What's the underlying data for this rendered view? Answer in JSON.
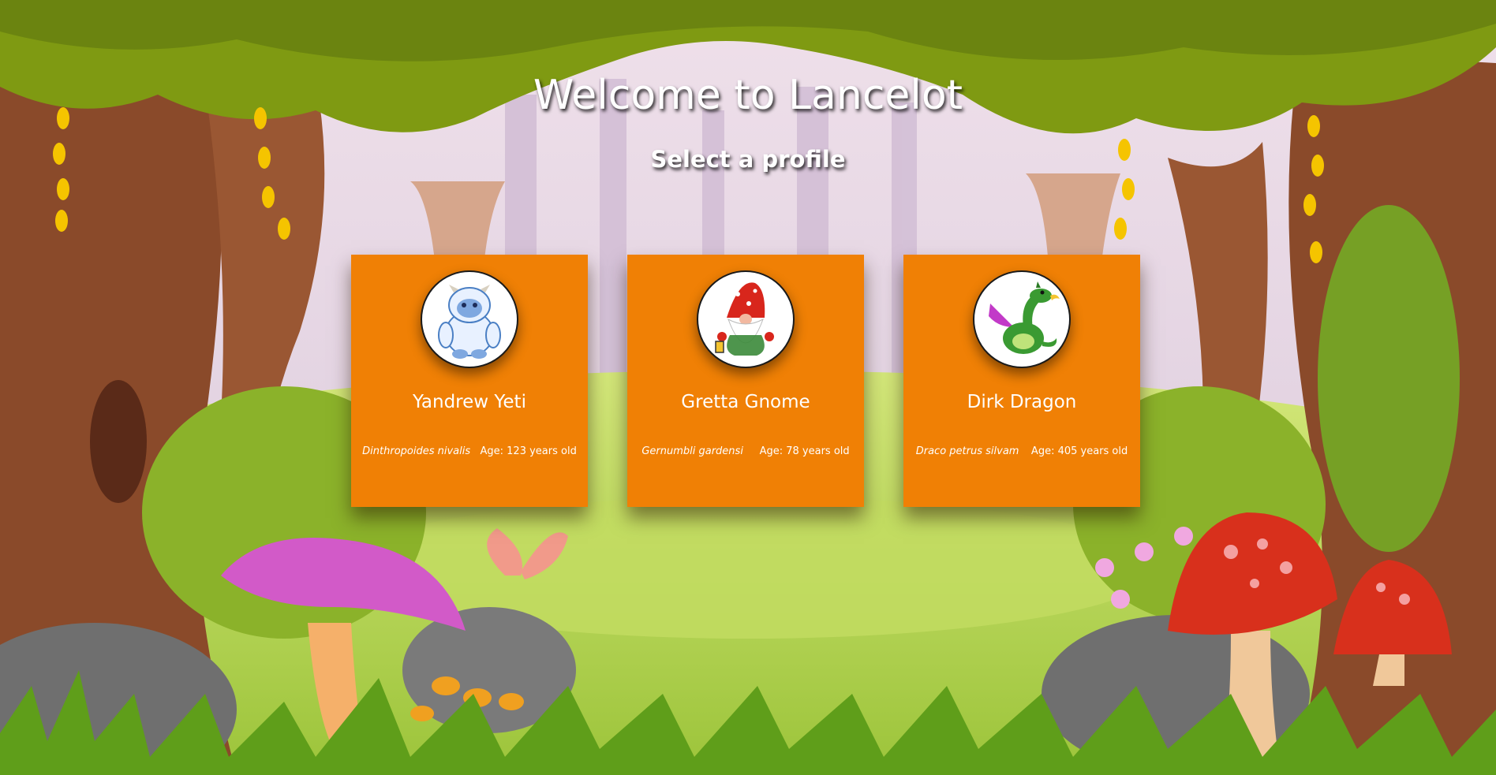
{
  "page": {
    "title": "Welcome to Lancelot",
    "subtitle": "Select a profile"
  },
  "colors": {
    "card": "#f08005",
    "text": "#ffffff"
  },
  "profiles": [
    {
      "name": "Yandrew Yeti",
      "species": "Dinthropoides nivalis",
      "age": "Age: 123 years old",
      "icon": "yeti-avatar-icon"
    },
    {
      "name": "Gretta Gnome",
      "species": "Gernumbli gardensi",
      "age": "Age: 78 years old",
      "icon": "gnome-avatar-icon"
    },
    {
      "name": "Dirk Dragon",
      "species": "Draco petrus silvam",
      "age": "Age: 405 years old",
      "icon": "dragon-avatar-icon"
    }
  ]
}
